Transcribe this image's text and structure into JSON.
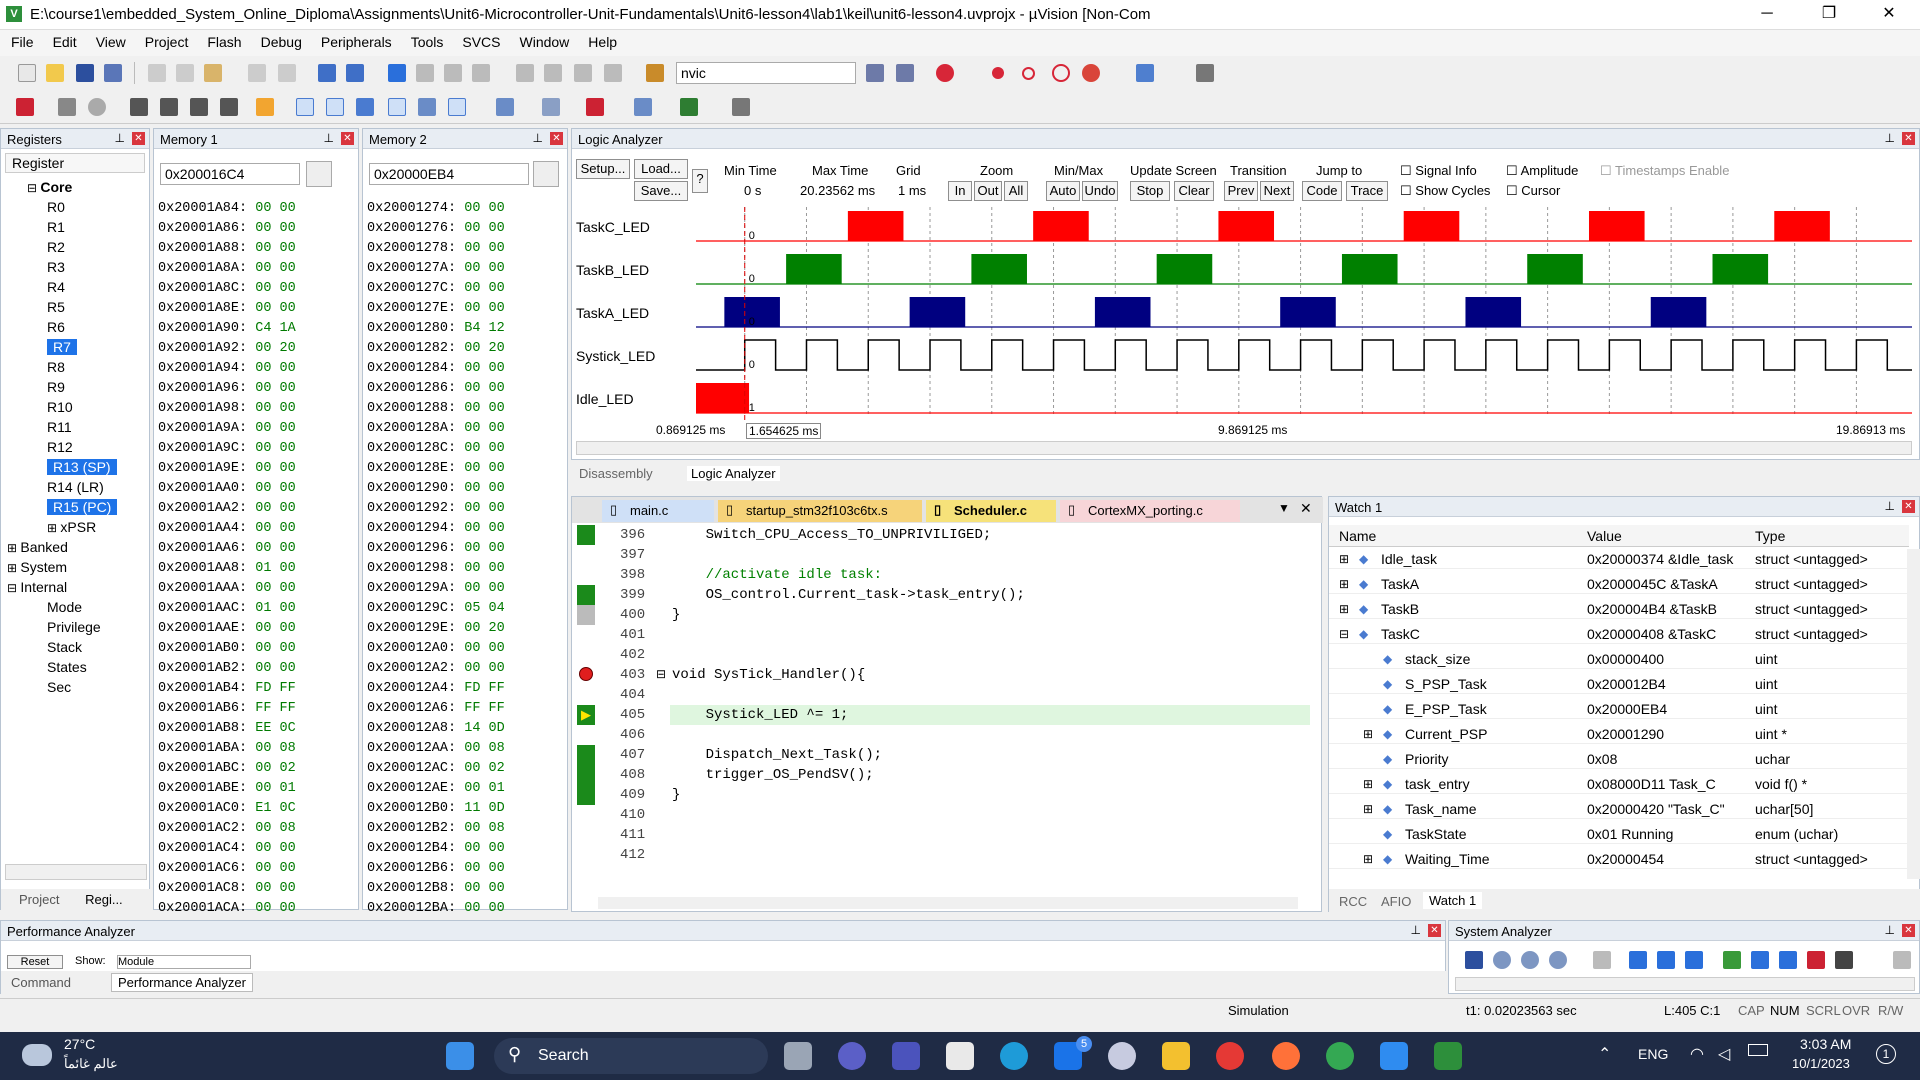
{
  "window": {
    "title": "E:\\course1\\embedded_System_Online_Diploma\\Assignments\\Unit6-Microcontroller-Unit-Fundamentals\\Unit6-lesson4\\lab1\\keil\\unit6-lesson4.uvprojx - µVision  [Non-Com",
    "minimize": "─",
    "maximize": "❐",
    "close": "✕"
  },
  "menu": [
    "File",
    "Edit",
    "View",
    "Project",
    "Flash",
    "Debug",
    "Peripherals",
    "Tools",
    "SVCS",
    "Window",
    "Help"
  ],
  "toolbar": {
    "find_value": "nvic"
  },
  "registers": {
    "title": "Registers",
    "column": "Register",
    "items": [
      {
        "label": "Core",
        "indent": 1,
        "bold": true,
        "expander": "⊟"
      },
      {
        "label": "R0",
        "indent": 2
      },
      {
        "label": "R1",
        "indent": 2
      },
      {
        "label": "R2",
        "indent": 2
      },
      {
        "label": "R3",
        "indent": 2
      },
      {
        "label": "R4",
        "indent": 2
      },
      {
        "label": "R5",
        "indent": 2
      },
      {
        "label": "R6",
        "indent": 2
      },
      {
        "label": "R7",
        "indent": 2,
        "selected": true
      },
      {
        "label": "R8",
        "indent": 2
      },
      {
        "label": "R9",
        "indent": 2
      },
      {
        "label": "R10",
        "indent": 2
      },
      {
        "label": "R11",
        "indent": 2
      },
      {
        "label": "R12",
        "indent": 2
      },
      {
        "label": "R13 (SP)",
        "indent": 2,
        "selected": true
      },
      {
        "label": "R14 (LR)",
        "indent": 2
      },
      {
        "label": "R15 (PC)",
        "indent": 2,
        "selected": true
      },
      {
        "label": "xPSR",
        "indent": 2,
        "expander": "⊞"
      },
      {
        "label": "Banked",
        "indent": 0,
        "expander": "⊞"
      },
      {
        "label": "System",
        "indent": 0,
        "expander": "⊞"
      },
      {
        "label": "Internal",
        "indent": 0,
        "expander": "⊟"
      },
      {
        "label": "Mode",
        "indent": 2
      },
      {
        "label": "Privilege",
        "indent": 2
      },
      {
        "label": "Stack",
        "indent": 2
      },
      {
        "label": "States",
        "indent": 2
      },
      {
        "label": "Sec",
        "indent": 2
      }
    ],
    "tabs": [
      "Project",
      "Regi..."
    ]
  },
  "memory1": {
    "title": "Memory 1",
    "address": "0x200016C4",
    "rows": [
      [
        "0x20001A84:",
        "00 00"
      ],
      [
        "0x20001A86:",
        "00 00"
      ],
      [
        "0x20001A88:",
        "00 00"
      ],
      [
        "0x20001A8A:",
        "00 00"
      ],
      [
        "0x20001A8C:",
        "00 00"
      ],
      [
        "0x20001A8E:",
        "00 00"
      ],
      [
        "0x20001A90:",
        "C4 1A"
      ],
      [
        "0x20001A92:",
        "00 20"
      ],
      [
        "0x20001A94:",
        "00 00"
      ],
      [
        "0x20001A96:",
        "00 00"
      ],
      [
        "0x20001A98:",
        "00 00"
      ],
      [
        "0x20001A9A:",
        "00 00"
      ],
      [
        "0x20001A9C:",
        "00 00"
      ],
      [
        "0x20001A9E:",
        "00 00"
      ],
      [
        "0x20001AA0:",
        "00 00"
      ],
      [
        "0x20001AA2:",
        "00 00"
      ],
      [
        "0x20001AA4:",
        "00 00"
      ],
      [
        "0x20001AA6:",
        "00 00"
      ],
      [
        "0x20001AA8:",
        "01 00"
      ],
      [
        "0x20001AAA:",
        "00 00"
      ],
      [
        "0x20001AAC:",
        "01 00"
      ],
      [
        "0x20001AAE:",
        "00 00"
      ],
      [
        "0x20001AB0:",
        "00 00"
      ],
      [
        "0x20001AB2:",
        "00 00"
      ],
      [
        "0x20001AB4:",
        "FD FF"
      ],
      [
        "0x20001AB6:",
        "FF FF"
      ],
      [
        "0x20001AB8:",
        "EE 0C"
      ],
      [
        "0x20001ABA:",
        "00 08"
      ],
      [
        "0x20001ABC:",
        "00 02"
      ],
      [
        "0x20001ABE:",
        "00 01"
      ],
      [
        "0x20001AC0:",
        "E1 0C"
      ],
      [
        "0x20001AC2:",
        "00 08"
      ],
      [
        "0x20001AC4:",
        "00 00"
      ],
      [
        "0x20001AC6:",
        "00 00"
      ],
      [
        "0x20001AC8:",
        "00 00"
      ],
      [
        "0x20001ACA:",
        "00 00"
      ]
    ]
  },
  "memory2": {
    "title": "Memory 2",
    "address": "0x20000EB4",
    "rows": [
      [
        "0x20001274:",
        "00 00"
      ],
      [
        "0x20001276:",
        "00 00"
      ],
      [
        "0x20001278:",
        "00 00"
      ],
      [
        "0x2000127A:",
        "00 00"
      ],
      [
        "0x2000127C:",
        "00 00"
      ],
      [
        "0x2000127E:",
        "00 00"
      ],
      [
        "0x20001280:",
        "B4 12"
      ],
      [
        "0x20001282:",
        "00 20"
      ],
      [
        "0x20001284:",
        "00 00"
      ],
      [
        "0x20001286:",
        "00 00"
      ],
      [
        "0x20001288:",
        "00 00"
      ],
      [
        "0x2000128A:",
        "00 00"
      ],
      [
        "0x2000128C:",
        "00 00"
      ],
      [
        "0x2000128E:",
        "00 00"
      ],
      [
        "0x20001290:",
        "00 00"
      ],
      [
        "0x20001292:",
        "00 00"
      ],
      [
        "0x20001294:",
        "00 00"
      ],
      [
        "0x20001296:",
        "00 00"
      ],
      [
        "0x20001298:",
        "00 00"
      ],
      [
        "0x2000129A:",
        "00 00"
      ],
      [
        "0x2000129C:",
        "05 04"
      ],
      [
        "0x2000129E:",
        "00 20"
      ],
      [
        "0x200012A0:",
        "00 00"
      ],
      [
        "0x200012A2:",
        "00 00"
      ],
      [
        "0x200012A4:",
        "FD FF"
      ],
      [
        "0x200012A6:",
        "FF FF"
      ],
      [
        "0x200012A8:",
        "14 0D"
      ],
      [
        "0x200012AA:",
        "00 08"
      ],
      [
        "0x200012AC:",
        "00 02"
      ],
      [
        "0x200012AE:",
        "00 01"
      ],
      [
        "0x200012B0:",
        "11 0D"
      ],
      [
        "0x200012B2:",
        "00 08"
      ],
      [
        "0x200012B4:",
        "00 00"
      ],
      [
        "0x200012B6:",
        "00 00"
      ],
      [
        "0x200012B8:",
        "00 00"
      ],
      [
        "0x200012BA:",
        "00 00"
      ]
    ]
  },
  "logic": {
    "title": "Logic Analyzer",
    "setup": "Setup...",
    "load": "Load...",
    "save": "Save...",
    "help": "?",
    "min_time_label": "Min Time",
    "min_time": "0 s",
    "max_time_label": "Max Time",
    "max_time": "20.23562 ms",
    "grid_label": "Grid",
    "grid": "1 ms",
    "zoom_label": "Zoom",
    "zoom_in": "In",
    "zoom_out": "Out",
    "zoom_all": "All",
    "minmax_label": "Min/Max",
    "auto": "Auto",
    "undo": "Undo",
    "update_label": "Update Screen",
    "stop": "Stop",
    "clear": "Clear",
    "transition_label": "Transition",
    "prev": "Prev",
    "next": "Next",
    "jump_label": "Jump to",
    "code": "Code",
    "trace": "Trace",
    "signal_info": "Signal Info",
    "show_cycles": "Show Cycles",
    "amplitude": "Amplitude",
    "cursor": "Cursor",
    "timestamps": "Timestamps Enable",
    "signals": [
      {
        "name": "TaskC_LED",
        "color": "#ff0000",
        "value": "0",
        "pulses": [
          [
            2.2,
            3.1
          ],
          [
            5.2,
            6.1
          ],
          [
            8.2,
            9.1
          ],
          [
            11.2,
            12.1
          ],
          [
            14.2,
            15.1
          ],
          [
            17.2,
            18.1
          ]
        ]
      },
      {
        "name": "TaskB_LED",
        "color": "#008000",
        "value": "0",
        "pulses": [
          [
            1.2,
            2.1
          ],
          [
            4.2,
            5.1
          ],
          [
            7.2,
            8.1
          ],
          [
            10.2,
            11.1
          ],
          [
            13.2,
            14.1
          ],
          [
            16.2,
            17.1
          ]
        ]
      },
      {
        "name": "TaskA_LED",
        "color": "#000080",
        "value": "0",
        "pulses": [
          [
            0.2,
            1.1
          ],
          [
            3.2,
            4.1
          ],
          [
            6.2,
            7.1
          ],
          [
            9.2,
            10.1
          ],
          [
            12.2,
            13.1
          ],
          [
            15.2,
            16.1
          ]
        ]
      },
      {
        "name": "Systick_LED",
        "color": "#000000",
        "value": "0",
        "clock": true
      },
      {
        "name": "Idle_LED",
        "color": "#ff0000",
        "value": "1",
        "pulses": [
          [
            -0.4,
            0.6
          ]
        ]
      }
    ],
    "t_start": "0.869125 ms",
    "t_cursor": "1.654625 ms",
    "t_mid": "9.869125 ms",
    "t_end": "19.86913 ms",
    "tabs": [
      "Disassembly",
      "Logic Analyzer"
    ]
  },
  "editor": {
    "tabs": [
      "main.c",
      "startup_stm32f103c6tx.s",
      "Scheduler.c",
      "CortexMX_porting.c"
    ],
    "active_tab": 2,
    "lines": [
      {
        "num": "396",
        "code": "    Switch_CPU_Access_TO_UNPRIVILIGED;"
      },
      {
        "num": "397",
        "code": ""
      },
      {
        "num": "398",
        "code": "    //activate idle task:",
        "comment": true
      },
      {
        "num": "399",
        "code": "    OS_control.Current_task->task_entry();"
      },
      {
        "num": "400",
        "code": "}"
      },
      {
        "num": "401",
        "code": ""
      },
      {
        "num": "402",
        "code": ""
      },
      {
        "num": "403",
        "code": "void SysTick_Handler(){"
      },
      {
        "num": "404",
        "code": ""
      },
      {
        "num": "405",
        "code": "    Systick_LED ^= 1;",
        "current": true
      },
      {
        "num": "406",
        "code": ""
      },
      {
        "num": "407",
        "code": "    Dispatch_Next_Task();"
      },
      {
        "num": "408",
        "code": "    trigger_OS_PendSV();"
      },
      {
        "num": "409",
        "code": "}"
      },
      {
        "num": "410",
        "code": ""
      },
      {
        "num": "411",
        "code": ""
      },
      {
        "num": "412",
        "code": ""
      }
    ]
  },
  "watch": {
    "title": "Watch 1",
    "col_name": "Name",
    "col_value": "Value",
    "col_type": "Type",
    "rows": [
      {
        "exp": "⊞",
        "name": "Idle_task",
        "value": "0x20000374 &Idle_task",
        "type": "struct <untagged>",
        "indent": 0
      },
      {
        "exp": "⊞",
        "name": "TaskA",
        "value": "0x2000045C &TaskA",
        "type": "struct <untagged>",
        "indent": 0
      },
      {
        "exp": "⊞",
        "name": "TaskB",
        "value": "0x200004B4 &TaskB",
        "type": "struct <untagged>",
        "indent": 0
      },
      {
        "exp": "⊟",
        "name": "TaskC",
        "value": "0x20000408 &TaskC",
        "type": "struct <untagged>",
        "indent": 0
      },
      {
        "exp": "",
        "name": "stack_size",
        "value": "0x00000400",
        "type": "uint",
        "indent": 1
      },
      {
        "exp": "",
        "name": "S_PSP_Task",
        "value": "0x200012B4",
        "type": "uint",
        "indent": 1
      },
      {
        "exp": "",
        "name": "E_PSP_Task",
        "value": "0x20000EB4",
        "type": "uint",
        "indent": 1
      },
      {
        "exp": "⊞",
        "name": "Current_PSP",
        "value": "0x20001290",
        "type": "uint *",
        "indent": 1
      },
      {
        "exp": "",
        "name": "Priority",
        "value": "0x08",
        "type": "uchar",
        "indent": 1
      },
      {
        "exp": "⊞",
        "name": "task_entry",
        "value": "0x08000D11 Task_C",
        "type": "void f()  *",
        "indent": 1
      },
      {
        "exp": "⊞",
        "name": "Task_name",
        "value": "0x20000420 \"Task_C\"",
        "type": "uchar[50]",
        "indent": 1
      },
      {
        "exp": "",
        "name": "TaskState",
        "value": "0x01 Running",
        "type": "enum (uchar)",
        "indent": 1
      },
      {
        "exp": "⊞",
        "name": "Waiting_Time",
        "value": "0x20000454",
        "type": "struct <untagged>",
        "indent": 1
      }
    ],
    "tabs": [
      "RCC",
      "AFIO",
      "Watch 1"
    ]
  },
  "perf": {
    "title": "Performance Analyzer",
    "reset": "Reset",
    "show": "Show:",
    "show_val": "Module",
    "tabs": [
      "Command",
      "Performance Analyzer"
    ]
  },
  "sysan": {
    "title": "System Analyzer"
  },
  "status": {
    "mode": "Simulation",
    "t1": "t1: 0.02023563 sec",
    "pos": "L:405 C:1",
    "caps": "CAP",
    "num": "NUM",
    "scrl": "SCRL",
    "ovr": "OVR",
    "rw": "R/W"
  },
  "taskbar": {
    "temp": "27°C",
    "weather": "عالم غائماً",
    "search": "Search",
    "lang": "ENG",
    "time": "3:03 AM",
    "date": "10/1/2023",
    "badge": "5",
    "notif": "1"
  }
}
